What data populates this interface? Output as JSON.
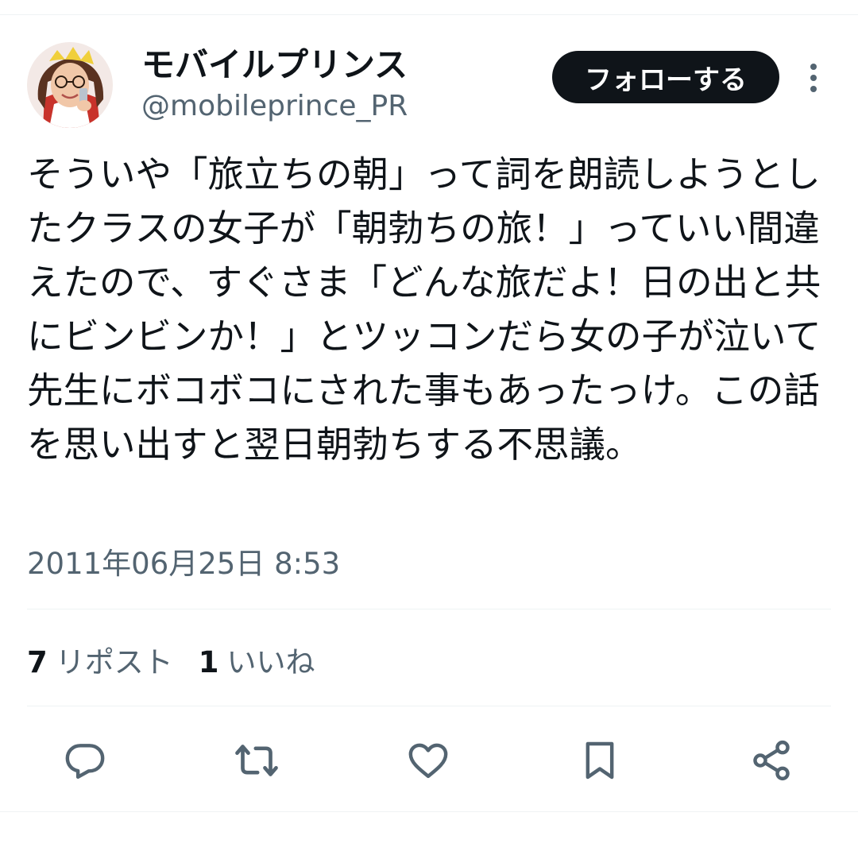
{
  "user": {
    "display_name": "モバイルプリンス",
    "handle": "@mobileprince_PR"
  },
  "follow_button_label": "フォローする",
  "tweet": {
    "text": "そういや「旅立ちの朝」って詞を朗読しようとしたクラスの女子が「朝勃ちの旅！」っていい間違えたので、すぐさま「どんな旅だよ！日の出と共にビンビンか！」とツッコンだら女の子が泣いて先生にボコボコにされた事もあったっけ。この話を思い出すと翌日朝勃ちする不思議。",
    "timestamp": "2011年06月25日 8:53"
  },
  "stats": {
    "reposts_count": "7",
    "reposts_label": "リポスト",
    "likes_count": "1",
    "likes_label": "いいね"
  },
  "actions": [
    "reply-icon",
    "repost-icon",
    "like-icon",
    "bookmark-icon",
    "share-icon"
  ],
  "colors": {
    "text_primary": "#0f1419",
    "text_secondary": "#536471",
    "button_bg": "#0f1419",
    "divider": "#eff3f4"
  }
}
